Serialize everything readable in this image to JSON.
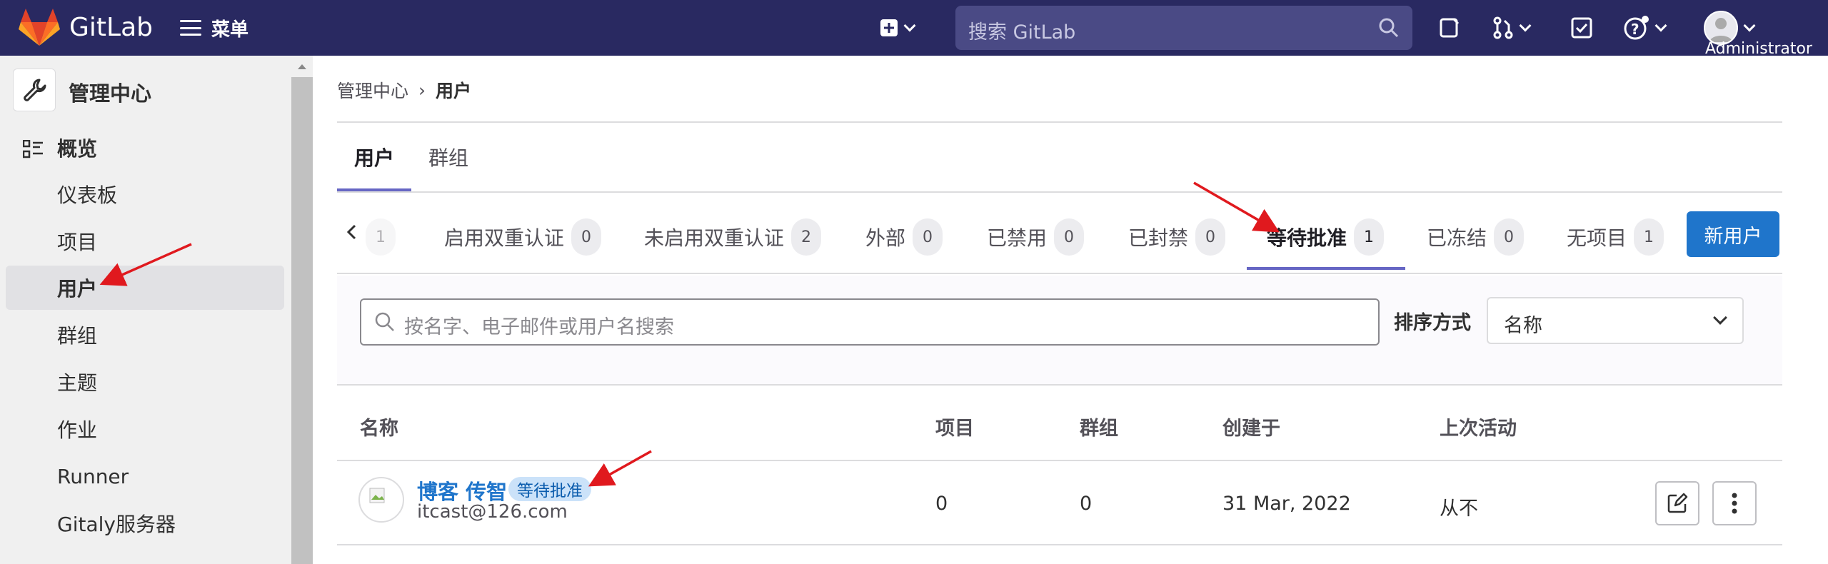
{
  "navbar": {
    "brand": "GitLab",
    "menu_label": "菜单",
    "search_placeholder": "搜索 GitLab",
    "user_name": "Administrator"
  },
  "sidebar": {
    "header": "管理中心",
    "section": "概览",
    "items": [
      "仪表板",
      "项目",
      "用户",
      "群组",
      "主题",
      "作业",
      "Runner",
      "Gitaly服务器"
    ],
    "active_item": "用户"
  },
  "breadcrumb": {
    "parent": "管理中心",
    "current": "用户"
  },
  "main_tabs": [
    "用户",
    "群组"
  ],
  "filter_tabs": [
    {
      "label": "启用双重认证",
      "count": "0"
    },
    {
      "label": "未启用双重认证",
      "count": "2"
    },
    {
      "label": "外部",
      "count": "0"
    },
    {
      "label": "已禁用",
      "count": "0"
    },
    {
      "label": "已封禁",
      "count": "0"
    },
    {
      "label": "等待批准",
      "count": "1"
    },
    {
      "label": "已冻结",
      "count": "0"
    },
    {
      "label": "无项目",
      "count": "1"
    }
  ],
  "partial_tab_count": "1",
  "new_user_button": "新用户",
  "filter": {
    "search_placeholder": "按名字、电子邮件或用户名搜索",
    "sort_label": "排序方式",
    "sort_value": "名称"
  },
  "table": {
    "headers": [
      "名称",
      "项目",
      "群组",
      "创建于",
      "上次活动"
    ],
    "rows": [
      {
        "name": "博客 传智",
        "badge": "等待批准",
        "email": "itcast@126.com",
        "projects": "0",
        "groups": "0",
        "created": "31 Mar, 2022",
        "last_activity": "从不"
      }
    ]
  },
  "colors": {
    "navbar": "#292961",
    "accent": "#1f75cb",
    "tab_underline": "#6666c4",
    "annotation_arrow": "#e0191e"
  }
}
